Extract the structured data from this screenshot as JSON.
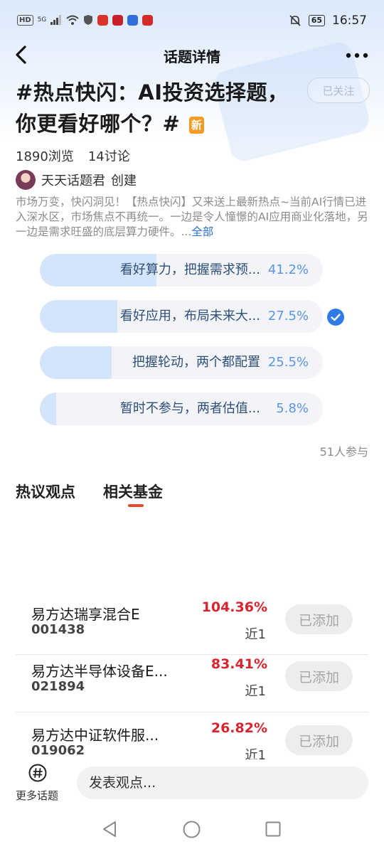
{
  "status_bar": {
    "left_labels": [
      "HD",
      "5G"
    ],
    "time": "16:57",
    "battery": "65"
  },
  "nav": {
    "title": "话题详情"
  },
  "topic": {
    "title": "#热点快闪：AI投资选择题，你更看好哪个？#",
    "new_badge": "新",
    "follow_label": "已关注",
    "views": "1890浏览",
    "discussions": "14讨论",
    "creator": "天天话题君",
    "creator_suffix": "创建",
    "description": "市场万变，快闪洞见！【热点快闪】又来送上最新热点~当前AI行情已进入深水区，市场焦点不再统一。一边是令人憧憬的AI应用商业化落地，另一边是需求旺盛的底层算力硬件。...",
    "description_more": "全部"
  },
  "poll": {
    "options": [
      {
        "label": "看好算力，把握需求预...",
        "percent_text": "41.2%",
        "percent": 41.2,
        "selected": false
      },
      {
        "label": "看好应用，布局未来大...",
        "percent_text": "27.5%",
        "percent": 27.5,
        "selected": true
      },
      {
        "label": "把握轮动，两个都配置",
        "percent_text": "25.5%",
        "percent": 25.5,
        "selected": false
      },
      {
        "label": "暂时不参与，两者估值...",
        "percent_text": "5.8%",
        "percent": 5.8,
        "selected": false
      }
    ],
    "participants": "51人参与"
  },
  "tabs": {
    "hot_views": "热议观点",
    "related_funds": "相关基金",
    "active": "related_funds"
  },
  "funds": [
    {
      "name": "易方达瑞享混合E",
      "code": "001438",
      "return": "104.36%",
      "period": "近1",
      "button": "已添加"
    },
    {
      "name": "易方达半导体设备E...",
      "code": "021894",
      "return": "83.41%",
      "period": "近1",
      "button": "已添加"
    },
    {
      "name": "易方达中证软件服...",
      "code": "019062",
      "return": "26.82%",
      "period": "近1",
      "button": "已添加"
    }
  ],
  "bottom": {
    "more_topics": "更多话题",
    "comment_placeholder": "发表观点..."
  },
  "colors": {
    "accent_blue": "#2a6fd6",
    "return_red": "#d6252e",
    "tab_indicator": "#e8492d",
    "new_badge": "#f59a23"
  }
}
